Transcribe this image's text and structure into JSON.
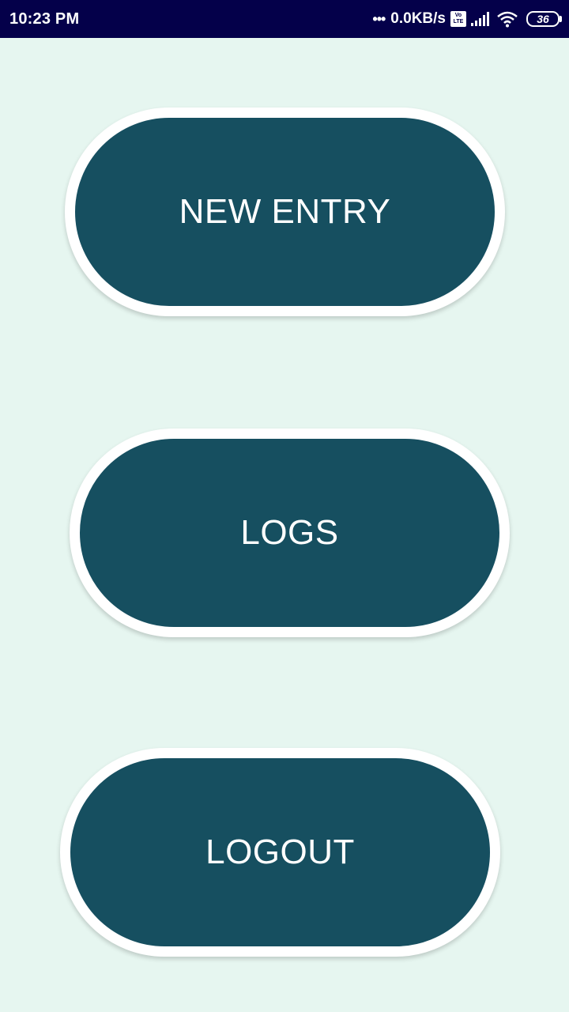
{
  "status_bar": {
    "time": "10:23 PM",
    "dots": "•••",
    "network_speed": "0.0KB/s",
    "volte_top": "Vo",
    "volte_bottom": "LTE",
    "battery": "36",
    "icons": [
      "volte-icon",
      "signal-icon",
      "wifi-icon",
      "battery-icon"
    ]
  },
  "menu": {
    "new_entry_label": "NEW ENTRY",
    "logs_label": "LOGS",
    "logout_label": "LOGOUT"
  },
  "colors": {
    "background": "#e6f6f0",
    "status_bar": "#04004a",
    "button_fill": "#164f60",
    "button_border": "#ffffff",
    "button_text": "#ffffff"
  }
}
